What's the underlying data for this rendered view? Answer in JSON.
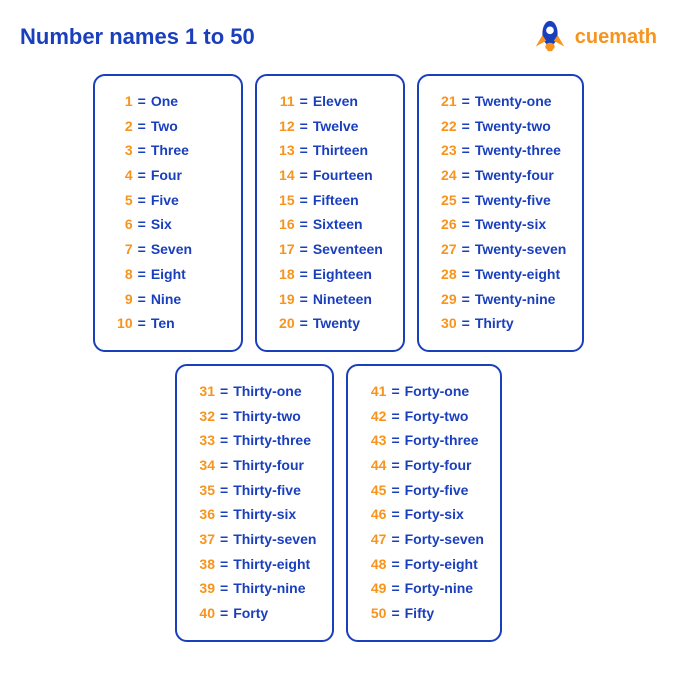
{
  "title": "Number names 1 to 50",
  "logo": {
    "text_cue": "cue",
    "text_math": "math"
  },
  "col1": [
    {
      "num": "1",
      "name": "One"
    },
    {
      "num": "2",
      "name": "Two"
    },
    {
      "num": "3",
      "name": "Three"
    },
    {
      "num": "4",
      "name": "Four"
    },
    {
      "num": "5",
      "name": "Five"
    },
    {
      "num": "6",
      "name": "Six"
    },
    {
      "num": "7",
      "name": "Seven"
    },
    {
      "num": "8",
      "name": "Eight"
    },
    {
      "num": "9",
      "name": "Nine"
    },
    {
      "num": "10",
      "name": "Ten"
    }
  ],
  "col2": [
    {
      "num": "11",
      "name": "Eleven"
    },
    {
      "num": "12",
      "name": "Twelve"
    },
    {
      "num": "13",
      "name": "Thirteen"
    },
    {
      "num": "14",
      "name": "Fourteen"
    },
    {
      "num": "15",
      "name": "Fifteen"
    },
    {
      "num": "16",
      "name": "Sixteen"
    },
    {
      "num": "17",
      "name": "Seventeen"
    },
    {
      "num": "18",
      "name": "Eighteen"
    },
    {
      "num": "19",
      "name": "Nineteen"
    },
    {
      "num": "20",
      "name": "Twenty"
    }
  ],
  "col3": [
    {
      "num": "21",
      "name": "Twenty-one"
    },
    {
      "num": "22",
      "name": "Twenty-two"
    },
    {
      "num": "23",
      "name": "Twenty-three"
    },
    {
      "num": "24",
      "name": "Twenty-four"
    },
    {
      "num": "25",
      "name": "Twenty-five"
    },
    {
      "num": "26",
      "name": "Twenty-six"
    },
    {
      "num": "27",
      "name": "Twenty-seven"
    },
    {
      "num": "28",
      "name": "Twenty-eight"
    },
    {
      "num": "29",
      "name": "Twenty-nine"
    },
    {
      "num": "30",
      "name": "Thirty"
    }
  ],
  "col4": [
    {
      "num": "31",
      "name": "Thirty-one"
    },
    {
      "num": "32",
      "name": "Thirty-two"
    },
    {
      "num": "33",
      "name": "Thirty-three"
    },
    {
      "num": "34",
      "name": "Thirty-four"
    },
    {
      "num": "35",
      "name": "Thirty-five"
    },
    {
      "num": "36",
      "name": "Thirty-six"
    },
    {
      "num": "37",
      "name": "Thirty-seven"
    },
    {
      "num": "38",
      "name": "Thirty-eight"
    },
    {
      "num": "39",
      "name": "Thirty-nine"
    },
    {
      "num": "40",
      "name": "Forty"
    }
  ],
  "col5": [
    {
      "num": "41",
      "name": "Forty-one"
    },
    {
      "num": "42",
      "name": "Forty-two"
    },
    {
      "num": "43",
      "name": "Forty-three"
    },
    {
      "num": "44",
      "name": "Forty-four"
    },
    {
      "num": "45",
      "name": "Forty-five"
    },
    {
      "num": "46",
      "name": "Forty-six"
    },
    {
      "num": "47",
      "name": "Forty-seven"
    },
    {
      "num": "48",
      "name": "Forty-eight"
    },
    {
      "num": "49",
      "name": "Forty-nine"
    },
    {
      "num": "50",
      "name": "Fifty"
    }
  ]
}
